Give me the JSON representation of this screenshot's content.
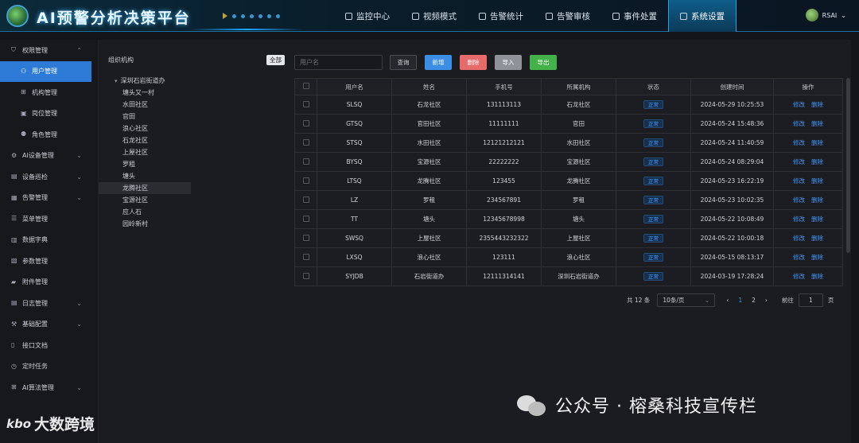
{
  "header": {
    "title": "AI预警分析决策平台",
    "nav": [
      {
        "label": "监控中心",
        "icon": "monitor-icon",
        "active": false
      },
      {
        "label": "视频模式",
        "icon": "video-icon",
        "active": false
      },
      {
        "label": "告警统计",
        "icon": "chart-icon",
        "active": false
      },
      {
        "label": "告警审核",
        "icon": "warning-icon",
        "active": false
      },
      {
        "label": "事件处置",
        "icon": "event-icon",
        "active": false
      },
      {
        "label": "系统设置",
        "icon": "gear-icon",
        "active": true
      }
    ],
    "user": "RSAI"
  },
  "sidebar": {
    "items": [
      {
        "label": "权限管理",
        "icon": "shield-icon",
        "expand": "up"
      },
      {
        "label": "用户管理",
        "icon": "user-icon",
        "sub": true,
        "active": true
      },
      {
        "label": "机构管理",
        "icon": "org-icon",
        "sub": true
      },
      {
        "label": "岗位管理",
        "icon": "post-icon",
        "sub": true
      },
      {
        "label": "角色管理",
        "icon": "role-icon",
        "sub": true
      },
      {
        "label": "AI设备管理",
        "icon": "device-icon",
        "expand": "down"
      },
      {
        "label": "设备巡检",
        "icon": "inspect-icon",
        "expand": "down"
      },
      {
        "label": "告警管理",
        "icon": "alarm-icon",
        "expand": "down"
      },
      {
        "label": "菜单管理",
        "icon": "menu-icon"
      },
      {
        "label": "数据字典",
        "icon": "dict-icon"
      },
      {
        "label": "参数管理",
        "icon": "param-icon"
      },
      {
        "label": "附件管理",
        "icon": "folder-icon"
      },
      {
        "label": "日志管理",
        "icon": "log-icon",
        "expand": "down"
      },
      {
        "label": "基础配置",
        "icon": "wrench-icon",
        "expand": "down"
      },
      {
        "label": "接口文档",
        "icon": "doc-icon"
      },
      {
        "label": "定时任务",
        "icon": "clock-icon"
      },
      {
        "label": "AI算法管理",
        "icon": "algo-icon",
        "expand": "down"
      }
    ]
  },
  "org": {
    "title": "组织机构",
    "all_btn": "全部",
    "root": "深圳石岩街道办",
    "nodes": [
      "塘头又一村",
      "水田社区",
      "官田",
      "浪心社区",
      "石龙社区",
      "上屋社区",
      "罗租",
      "塘头",
      "龙腾社区",
      "宝源社区",
      "应人石",
      "园岭新村"
    ],
    "selected": "龙腾社区"
  },
  "toolbar": {
    "search_placeholder": "用户名",
    "query": "查询",
    "add": "新增",
    "delete": "删除",
    "import": "导入",
    "export": "导出"
  },
  "table": {
    "headers": [
      "用户名",
      "姓名",
      "手机号",
      "所属机构",
      "状态",
      "创建时间",
      "操作"
    ],
    "edit": "修改",
    "del": "删除",
    "rows": [
      [
        "SLSQ",
        "石龙社区",
        "131113113",
        "石龙社区",
        "正常",
        "2024-05-29 10:25:53"
      ],
      [
        "GTSQ",
        "官田社区",
        "11111111",
        "官田",
        "正常",
        "2024-05-24 15:48:36"
      ],
      [
        "STSQ",
        "水田社区",
        "12121212121",
        "水田社区",
        "正常",
        "2024-05-24 11:40:59"
      ],
      [
        "BYSQ",
        "宝源社区",
        "22222222",
        "宝源社区",
        "正常",
        "2024-05-24 08:29:04"
      ],
      [
        "LTSQ",
        "龙腾社区",
        "123455",
        "龙腾社区",
        "正常",
        "2024-05-23 16:22:19"
      ],
      [
        "LZ",
        "罗租",
        "234567891",
        "罗租",
        "正常",
        "2024-05-23 10:02:35"
      ],
      [
        "TT",
        "塘头",
        "12345678998",
        "塘头",
        "正常",
        "2024-05-22 10:08:49"
      ],
      [
        "SWSQ",
        "上屋社区",
        "2355443232322",
        "上屋社区",
        "正常",
        "2024-05-22 10:00:18"
      ],
      [
        "LXSQ",
        "浪心社区",
        "123111",
        "浪心社区",
        "正常",
        "2024-05-15 08:13:17"
      ],
      [
        "SYJDB",
        "石岩街道办",
        "12111314141",
        "深圳石岩街道办",
        "正常",
        "2024-03-19 17:28:24"
      ]
    ]
  },
  "pager": {
    "total": "共 12 条",
    "size": "10条/页",
    "pages": [
      "1",
      "2"
    ],
    "current": "1",
    "goto": "前往",
    "goto_value": "1",
    "page_unit": "页"
  },
  "watermark": {
    "wechat": "公众号 · 榕桑科技宣传栏",
    "brand": "大数跨境",
    "brand_logo": "kbo"
  }
}
